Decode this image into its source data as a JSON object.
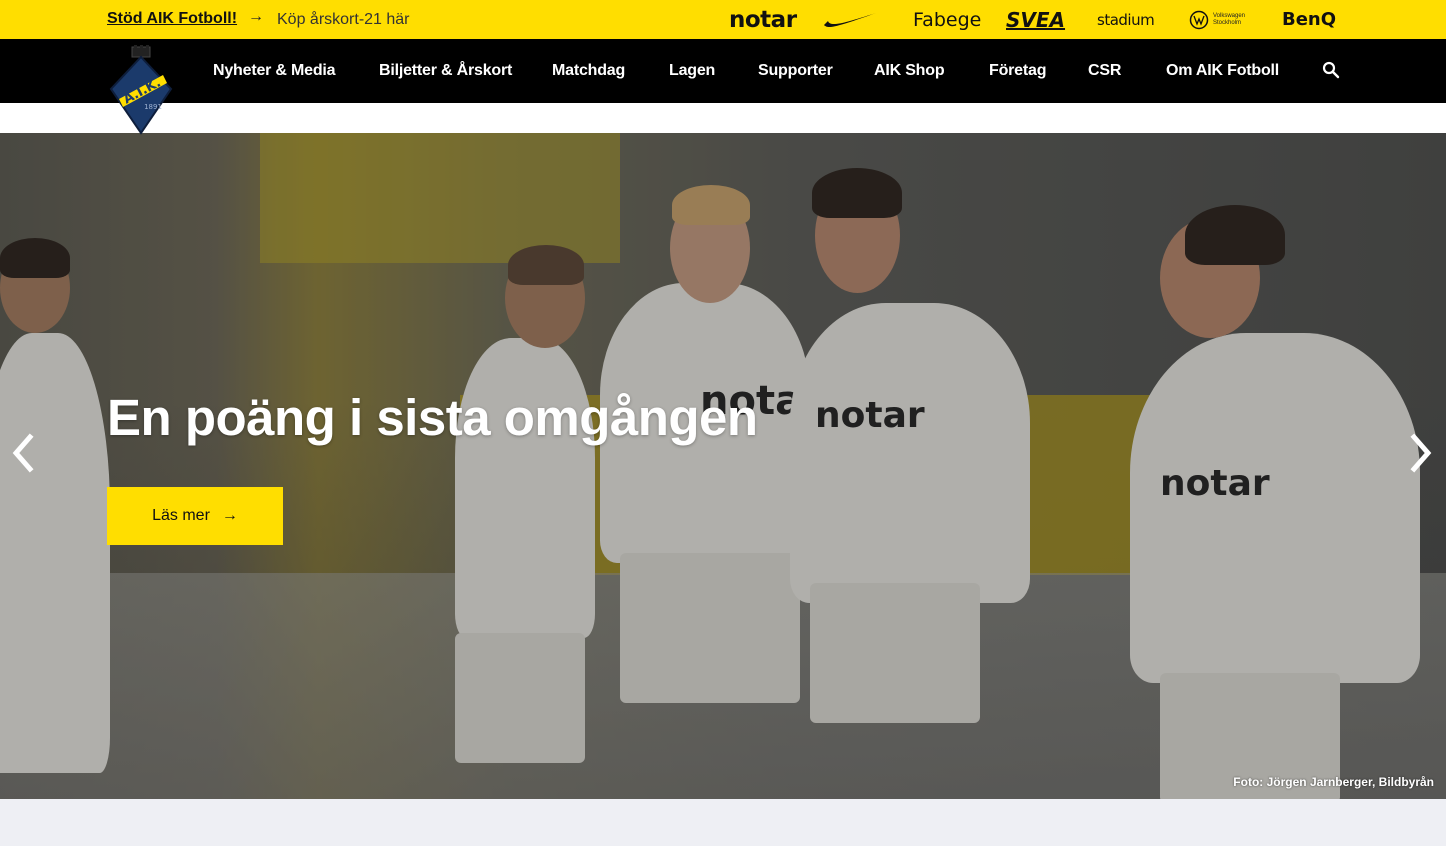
{
  "topbar": {
    "support_link": "Stöd AIK Fotboll!",
    "arrow_icon": "arrow-right-icon",
    "ticket_text": "Köp årskort-21 här",
    "sponsors": {
      "notar": "notar",
      "nike": "nike-logo",
      "fabege": "Fabege",
      "svea": "SVEA",
      "stadium": "stadium",
      "vw_line1": "Volkswagen",
      "vw_line2": "Stockholm",
      "benq": "BenQ"
    },
    "accent_color": "#ffde00"
  },
  "nav": {
    "logo": "aik-crest-logo",
    "items": [
      "Nyheter & Media",
      "Biljetter & Årskort",
      "Matchdag",
      "Lagen",
      "Supporter",
      "AIK Shop",
      "Företag",
      "CSR",
      "Om AIK Fotboll"
    ],
    "search_icon": "search-icon"
  },
  "hero": {
    "title": "En poäng i sista omgången",
    "button_label": "Läs mer",
    "prev_icon": "chevron-left-icon",
    "next_icon": "chevron-right-icon",
    "photo_credit": "Foto: Jörgen Jarnberger, Bildbyrån",
    "shirt_text": "notar"
  }
}
